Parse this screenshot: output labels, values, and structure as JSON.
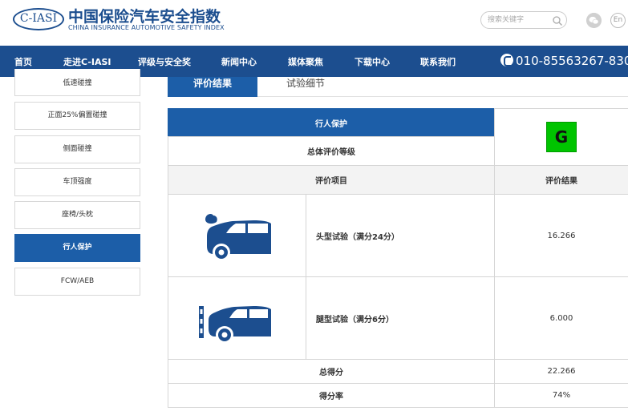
{
  "header": {
    "logo_text": "C-IASI",
    "title_cn": "中国保险汽车安全指数",
    "title_en": "CHINA INSURANCE AUTOMOTIVE SAFETY INDEX",
    "search_placeholder": "搜索关键字",
    "lang_label": "En"
  },
  "nav": {
    "items": [
      "首页",
      "走进C-IASI",
      "评级与安全奖",
      "新闻中心",
      "媒体聚焦",
      "下载中心",
      "联系我们"
    ],
    "phone": "010-85563267-830"
  },
  "sidebar": {
    "items": [
      "低速碰撞",
      "正面25%偏置碰撞",
      "侧面碰撞",
      "车顶强度",
      "座椅/头枕",
      "行人保护",
      "FCW/AEB"
    ],
    "active": "行人保护"
  },
  "tabs": {
    "active": "评价结果",
    "other": "试验细节"
  },
  "table": {
    "category": "行人保护",
    "overall_label": "总体评价等级",
    "grade": "G",
    "grade_color": "#00c400",
    "col_item": "评价项目",
    "col_result": "评价结果",
    "rows": [
      {
        "name": "头型试验（满分24分）",
        "value": "16.266",
        "icon": "car-head-impact-icon"
      },
      {
        "name": "腿型试验（满分6分）",
        "value": "6.000",
        "icon": "car-leg-impact-icon"
      }
    ],
    "total_label": "总得分",
    "total_value": "22.266",
    "rate_label": "得分率",
    "rate_value": "74%"
  },
  "colors": {
    "brand_blue": "#1c4e8f",
    "active_blue": "#1c5ea8"
  }
}
